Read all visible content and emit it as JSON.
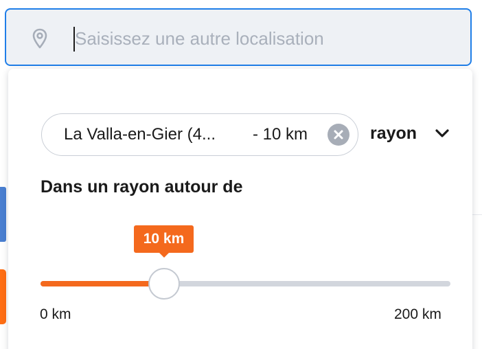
{
  "search": {
    "placeholder": "Saisissez une autre localisation",
    "value": ""
  },
  "location_chip": {
    "location": "La Valla-en-Gier (4...",
    "distance": "- 10 km"
  },
  "radius_select": {
    "label": "rayon"
  },
  "radius_heading": "Dans un rayon autour de",
  "slider": {
    "tooltip": "10 km",
    "min_label": "0 km",
    "max_label": "200 km",
    "value_km": 10
  },
  "colors": {
    "accent_orange": "#f4691d",
    "focus_blue": "#1f7ee8",
    "track_gray": "#d2d6dd",
    "side_blue": "#4a7fd1"
  },
  "icons": {
    "search_leading": "map-pin-icon",
    "chip_clear": "clear-circle-icon",
    "select_toggle": "chevron-down-icon"
  }
}
